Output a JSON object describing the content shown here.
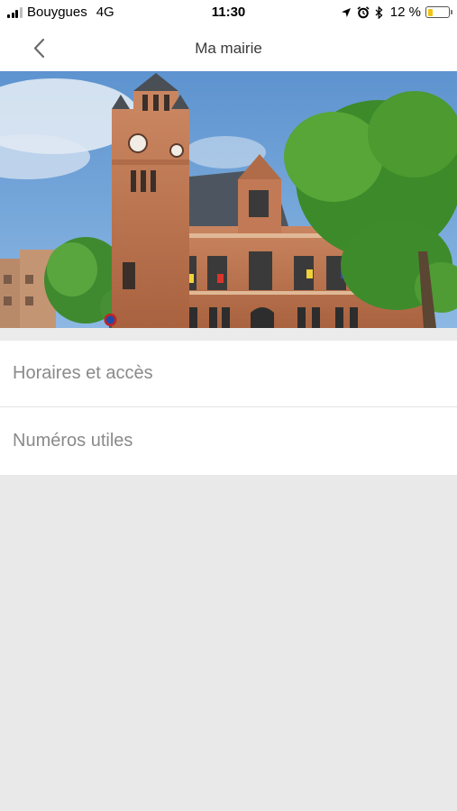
{
  "status_bar": {
    "carrier": "Bouygues",
    "network": "4G",
    "time": "11:30",
    "battery_percent": "12 %",
    "battery_level": 0.12,
    "icons": [
      "location-arrow-icon",
      "alarm-icon",
      "bluetooth-icon",
      "battery-icon"
    ]
  },
  "nav": {
    "title": "Ma mairie",
    "back_icon": "chevron-left-icon"
  },
  "hero": {
    "image": "town-hall-photo"
  },
  "menu": {
    "items": [
      {
        "label": "Horaires et accès"
      },
      {
        "label": "Numéros utiles"
      }
    ]
  },
  "colors": {
    "background": "#e9e9e9",
    "bar_background": "#ffffff",
    "menu_text": "#8a8a8a",
    "battery_fill": "#f2c40f"
  }
}
